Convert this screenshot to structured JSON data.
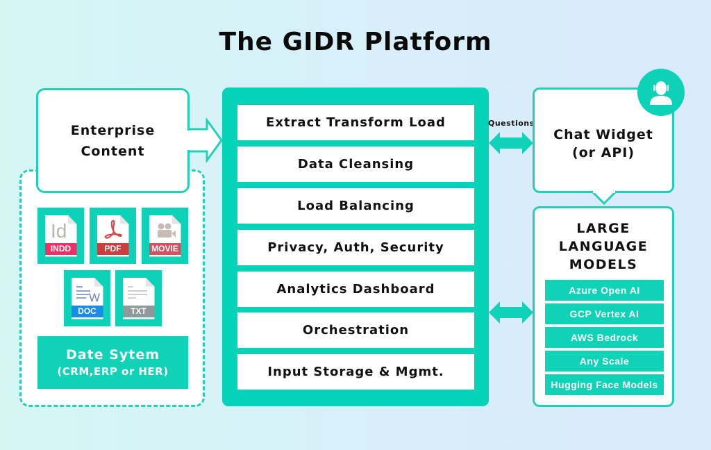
{
  "title": "The GIDR Platform",
  "enterprise_content": {
    "line1": "Enterprise",
    "line2": "Content"
  },
  "files": [
    {
      "label": "INDD",
      "icon": "indesign-file-icon",
      "color": "#ef2f65"
    },
    {
      "label": "PDF",
      "icon": "pdf-file-icon",
      "color": "#cc3d3d"
    },
    {
      "label": "MOVIE",
      "icon": "movie-file-icon",
      "color": "#d55060"
    },
    {
      "label": "DOC",
      "icon": "doc-file-icon",
      "color": "#1a8ce3"
    },
    {
      "label": "TXT",
      "icon": "txt-file-icon",
      "color": "#8e9a98"
    }
  ],
  "data_system": {
    "title": "Date Sytem",
    "subtitle": "(CRM,ERP or HER)"
  },
  "platform_layers": [
    "Extract Transform Load",
    "Data Cleansing",
    "Load Balancing",
    "Privacy, Auth, Security",
    "Analytics Dashboard",
    "Orchestration",
    "Input Storage & Mgmt."
  ],
  "questions_label": "Questions",
  "chat_widget": {
    "line1": "Chat Widget",
    "line2": "(or API)",
    "icon": "user-headset-icon"
  },
  "llm": {
    "title_lines": [
      "LARGE",
      "LANGUAGE",
      "MODELS"
    ],
    "providers": [
      "Azure Open AI",
      "GCP Vertex AI",
      "AWS Bedrock",
      "Any Scale",
      "Hugging Face Models"
    ]
  },
  "colors": {
    "accent": "#04d3b9",
    "border": "#22d0b6",
    "text": "#111111"
  }
}
